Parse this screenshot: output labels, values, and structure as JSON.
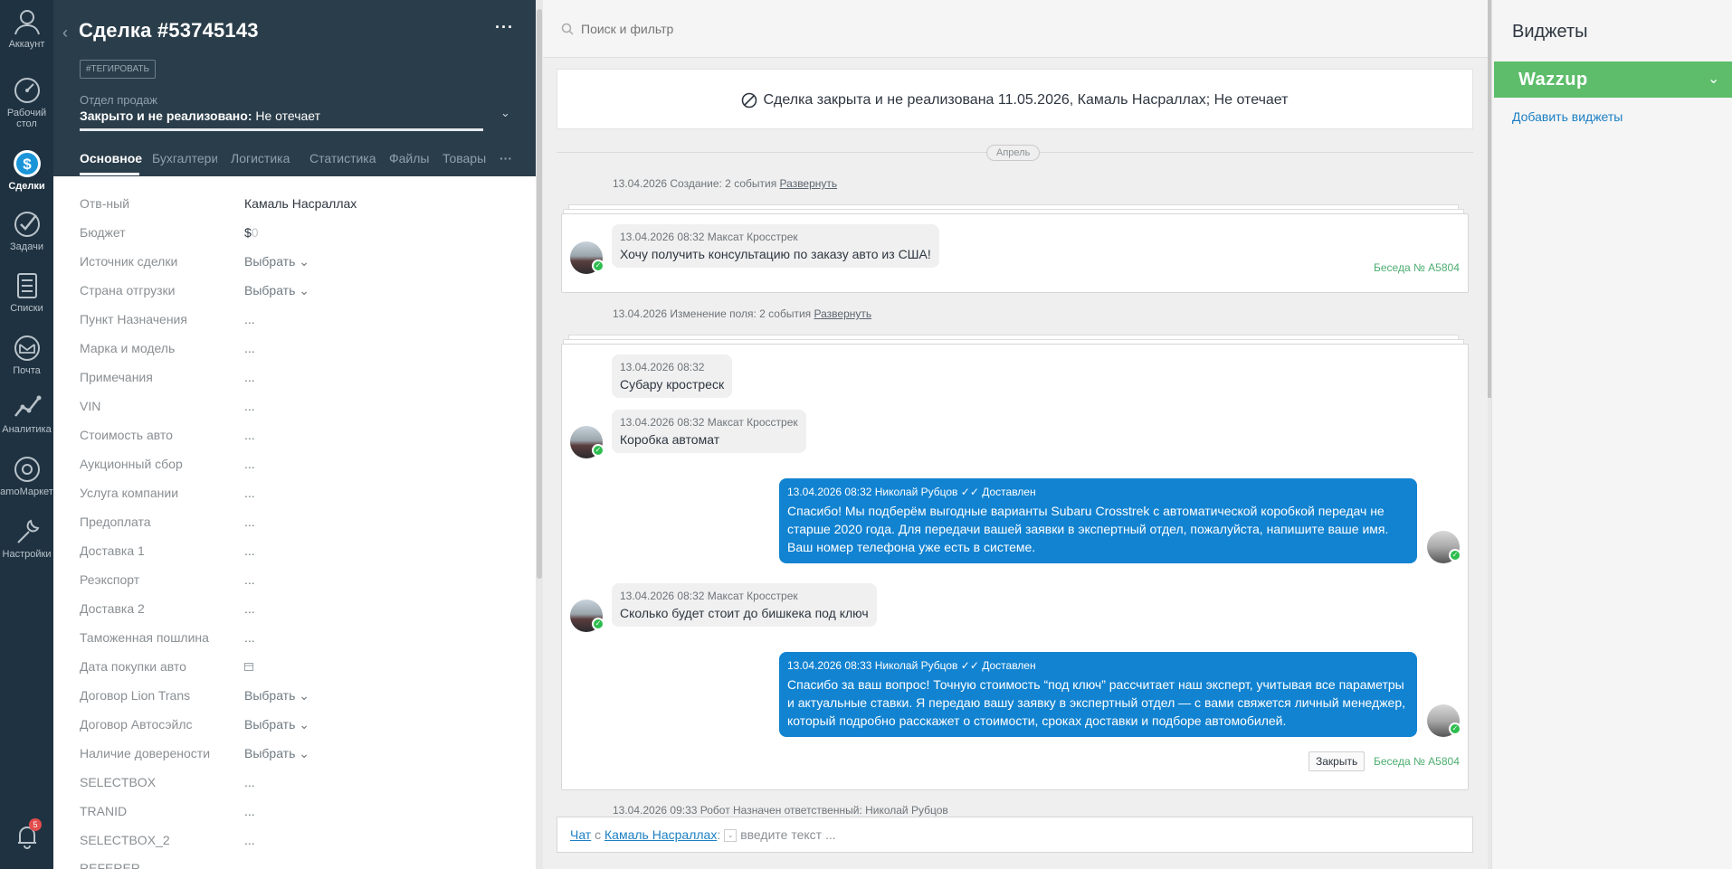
{
  "nav": {
    "items": [
      {
        "label": "Аккаунт",
        "icon": "account-icon"
      },
      {
        "label": "Рабочий стол",
        "line1": "Рабочий",
        "line2": "стол",
        "icon": "dashboard-icon"
      },
      {
        "label": "Сделки",
        "icon": "deals-icon"
      },
      {
        "label": "Задачи",
        "icon": "tasks-icon"
      },
      {
        "label": "Списки",
        "icon": "lists-icon"
      },
      {
        "label": "Почта",
        "icon": "mail-icon"
      },
      {
        "label": "Аналитика",
        "icon": "analytics-icon"
      },
      {
        "label": "amoМаркет",
        "icon": "market-icon"
      },
      {
        "label": "Настройки",
        "icon": "settings-icon"
      }
    ],
    "notifications_count": "5"
  },
  "card": {
    "title": "Сделка #53745143",
    "tag_button": "#ТЕГИРОВАТЬ",
    "pipeline": "Отдел продаж",
    "status_bold": "Закрыто и не реализовано:",
    "status_reason": "Не отечает",
    "tabs": [
      "Основное",
      "Бухгалтерия",
      "Логистика",
      "Статистика",
      "Файлы",
      "Товары"
    ],
    "tabs_more": "···",
    "fields": [
      {
        "label": "Отв-ный",
        "value": "Камаль Насраллах"
      },
      {
        "label": "Бюджет",
        "value_currency": "$",
        "value_amount": "0"
      },
      {
        "label": "Источник сделки",
        "value": "Выбрать"
      },
      {
        "label": "Страна отгрузки",
        "value": "Выбрать"
      },
      {
        "label": "Пункт Назначения",
        "value": "..."
      },
      {
        "label": "Марка и модель",
        "value": "..."
      },
      {
        "label": "Примечания",
        "value": "..."
      },
      {
        "label": "VIN",
        "value": "..."
      },
      {
        "label": "Стоимость авто",
        "value": "..."
      },
      {
        "label": "Аукционный сбор",
        "value": "..."
      },
      {
        "label": "Услуга компании",
        "value": "..."
      },
      {
        "label": "Предоплата",
        "value": "..."
      },
      {
        "label": "Доставка 1",
        "value": "..."
      },
      {
        "label": "Реэкспорт",
        "value": "..."
      },
      {
        "label": "Доставка 2",
        "value": "..."
      },
      {
        "label": "Таможенная пошлина",
        "value": "..."
      },
      {
        "label": "Дата покупки авто",
        "value": ""
      },
      {
        "label": "Договор Lion Trans",
        "value": "Выбрать"
      },
      {
        "label": "Договор Автосэйлс",
        "value": "Выбрать"
      },
      {
        "label": "Наличие довереноcти",
        "value": "Выбрать"
      },
      {
        "label": "SELECTBOX",
        "value": "..."
      },
      {
        "label": "TRANID",
        "value": "..."
      },
      {
        "label": "SELECTBOX_2",
        "value": "..."
      },
      {
        "label": "REFERER",
        "value": ""
      }
    ]
  },
  "feed": {
    "search_placeholder": "Поиск и фильтр",
    "closed_banner": "Сделка закрыта и не реализована 11.05.2026, Камаль Насраллах; Не отечает",
    "month": "Апрель",
    "event1": {
      "text": "13.04.2026 Создание: 2 события",
      "link": "Развернуть"
    },
    "msg1": {
      "meta": "13.04.2026 08:32 Максат Кросстрек",
      "text": "Хочу получить консультацию по заказу авто из США!"
    },
    "conv1": "Беседа № A5804",
    "event2": {
      "text": "13.04.2026 Изменение поля: 2 события",
      "link": "Развернуть"
    },
    "msg2": {
      "meta": "13.04.2026 08:32",
      "text": "Субару кростреск"
    },
    "msg3": {
      "meta": "13.04.2026 08:32 Максат Кросстрек",
      "text": "Коробка автомат"
    },
    "msg4": {
      "meta": "13.04.2026 08:32 Николай Рубцов",
      "status": "Доставлен",
      "text": "Спасибо! Мы подберём выгодные варианты Subaru Crosstrek с автоматической коробкой передач не старше 2020 года. Для передачи вашей заявки в экспертный отдел, пожалуйста, напишите ваше имя. Ваш номер телефона уже есть в системе."
    },
    "msg5": {
      "meta": "13.04.2026 08:32 Максат Кросстрек",
      "text": "Сколько будет стоит до бишкека под ключ"
    },
    "msg6": {
      "meta": "13.04.2026 08:33 Николай Рубцов",
      "status": "Доставлен",
      "text": "Спасибо за ваш вопрос! Точную стоимость “под ключ” рассчитает наш эксперт, учитывая все параметры и актуальные ставки. Я передаю вашу заявку в экспертный отдел — с вами свяжется личный менеджер, который подробно расскажет о стоимости, сроках доставки и подборе автомобилей."
    },
    "close_button": "Закрыть",
    "conv2": "Беседа № A5804",
    "event3": {
      "text": "13.04.2026 09:33 Робот Назначен ответственный: Николай Рубцов"
    },
    "chat": {
      "chat_link": "Чат",
      "with": "с",
      "contact": "Камаль Насраллах",
      "placeholder": "введите текст ..."
    }
  },
  "widgets": {
    "title": "Виджеты",
    "wazzup": "Wazzup",
    "add_link": "Добавить виджеты"
  }
}
